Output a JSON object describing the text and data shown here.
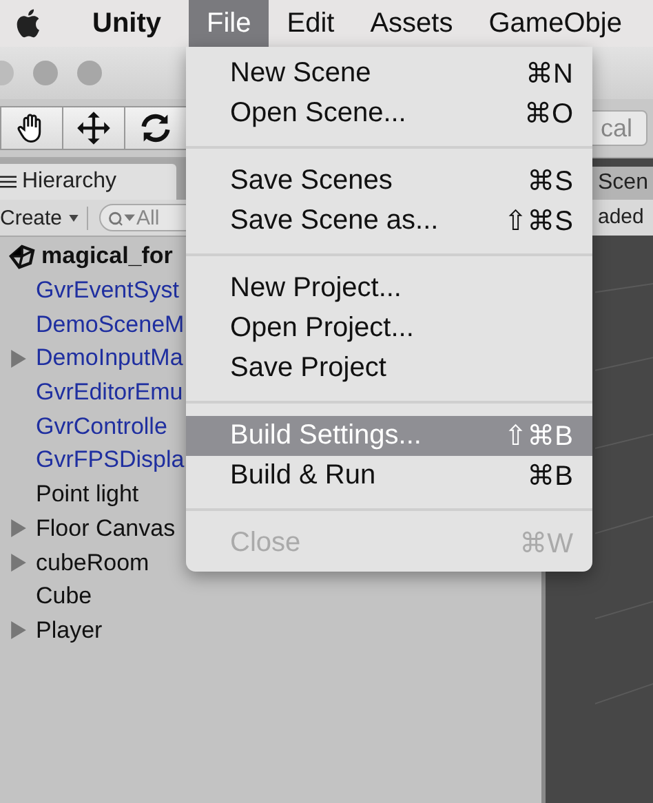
{
  "menu_bar": {
    "items": [
      {
        "label": "Unity",
        "kind": "app",
        "selected": false
      },
      {
        "label": "File",
        "kind": "menu",
        "selected": true
      },
      {
        "label": "Edit",
        "kind": "menu",
        "selected": false
      },
      {
        "label": "Assets",
        "kind": "menu",
        "selected": false
      },
      {
        "label": "GameObje",
        "kind": "menu",
        "selected": false
      }
    ]
  },
  "toolbar": {
    "right_button": "cal"
  },
  "tabs": [
    {
      "label": "Hierarchy",
      "selected": true
    },
    {
      "label": "Scen",
      "selected": false
    }
  ],
  "hierarchy": {
    "create": "Create",
    "search": {
      "placeholder": "All"
    },
    "scene_status": "aded",
    "scene": "magical_for",
    "items": [
      {
        "label": "GvrEventSyst",
        "prefab": true,
        "expandable": false
      },
      {
        "label": "DemoSceneM",
        "prefab": true,
        "expandable": false
      },
      {
        "label": "DemoInputMa",
        "prefab": true,
        "expandable": true
      },
      {
        "label": "GvrEditorEmu",
        "prefab": true,
        "expandable": false
      },
      {
        "label": "GvrControlle",
        "prefab": true,
        "expandable": false
      },
      {
        "label": "GvrFPSDispla",
        "prefab": true,
        "expandable": false
      },
      {
        "label": "Point light",
        "prefab": false,
        "expandable": false
      },
      {
        "label": "Floor Canvas",
        "prefab": false,
        "expandable": true
      },
      {
        "label": "cubeRoom",
        "prefab": false,
        "expandable": true
      },
      {
        "label": "Cube",
        "prefab": false,
        "expandable": false
      },
      {
        "label": "Player",
        "prefab": false,
        "expandable": true
      }
    ]
  },
  "file_menu": {
    "groups": [
      [
        {
          "label": "New Scene",
          "shortcut": "⌘N",
          "disabled": false,
          "selected": false
        },
        {
          "label": "Open Scene...",
          "shortcut": "⌘O",
          "disabled": false,
          "selected": false
        }
      ],
      [
        {
          "label": "Save Scenes",
          "shortcut": "⌘S",
          "disabled": false,
          "selected": false
        },
        {
          "label": "Save Scene as...",
          "shortcut": "⇧⌘S",
          "disabled": false,
          "selected": false
        }
      ],
      [
        {
          "label": "New Project...",
          "disabled": false,
          "selected": false
        },
        {
          "label": "Open Project...",
          "disabled": false,
          "selected": false
        },
        {
          "label": "Save Project",
          "disabled": false,
          "selected": false
        }
      ],
      [
        {
          "label": "Build Settings...",
          "shortcut": "⇧⌘B",
          "disabled": false,
          "selected": true
        },
        {
          "label": "Build & Run",
          "shortcut": "⌘B",
          "disabled": false,
          "selected": false
        }
      ],
      [
        {
          "label": "Close",
          "shortcut": "⌘W",
          "disabled": true,
          "selected": false
        }
      ]
    ]
  }
}
